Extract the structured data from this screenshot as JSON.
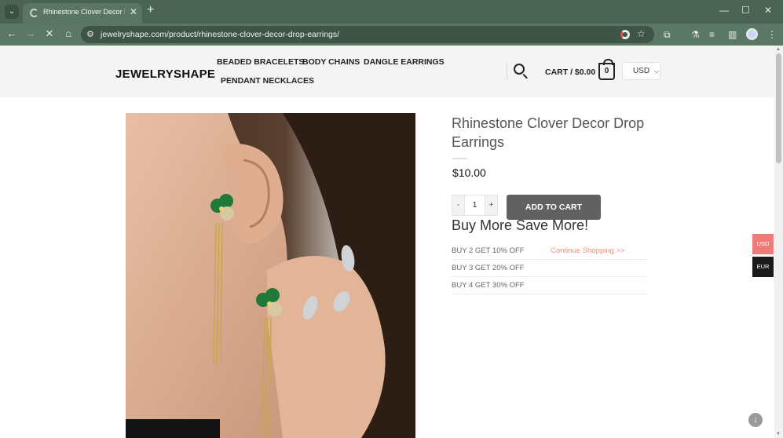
{
  "browser": {
    "tab_title": "Rhinestone Clover Decor Drop Earrings",
    "tab_close": "✕",
    "new_tab": "+",
    "window_controls": {
      "minimize": "—",
      "maximize": "☐",
      "close": "✕"
    },
    "nav": {
      "back": "←",
      "forward": "→",
      "stop": "✕",
      "home": "⌂"
    },
    "url": "jewelryshape.com/product/rhinestone-clover-decor-drop-earrings/",
    "icons": [
      "tab-list-icon",
      "site-info-icon",
      "google-lens-icon",
      "bookmark-star-icon",
      "extensions-icon",
      "labs-icon",
      "media-icon",
      "sidepanel-icon",
      "profile-icon",
      "menu-icon"
    ]
  },
  "site": {
    "logo": "JEWELRYSHAPE",
    "nav": [
      "BEADED BRACELETS",
      "BODY CHAINS",
      "DANGLE EARRINGS",
      "PENDANT NECKLACES"
    ],
    "cart_label": "CART / $0.00",
    "cart_count": "0",
    "currency": "USD"
  },
  "product": {
    "title": "Rhinestone Clover Decor Drop Earrings",
    "price": "$10.00",
    "qty_minus": "-",
    "qty_value": "1",
    "qty_plus": "+",
    "add_to_cart": "ADD TO CART",
    "promo_heading": "Buy More Save More!",
    "offers": [
      {
        "text": "BUY 2 GET 10% OFF",
        "link": "Continue Shopping >>"
      },
      {
        "text": "BUY 3 GET 20% OFF"
      },
      {
        "text": "BUY 4 GET 30% OFF"
      }
    ],
    "image_alt": "product-photo-earring"
  },
  "currency_switcher": {
    "usd": "USD",
    "eur": "EUR"
  },
  "colors": {
    "chrome": "#4a6352",
    "button": "#616161",
    "link": "#e88f78",
    "usd_active": "#f07a7a"
  }
}
